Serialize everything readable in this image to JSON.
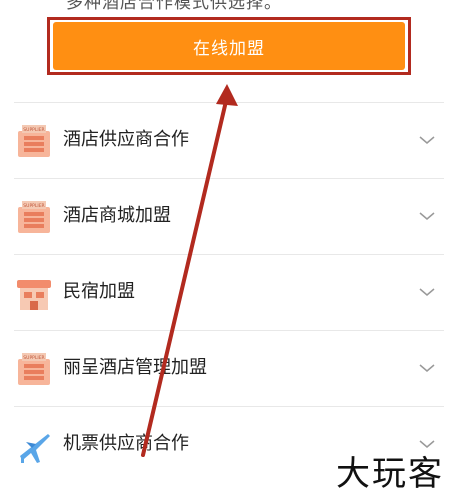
{
  "intro": {
    "text": "多种酒店合作模式供选择。"
  },
  "cta": {
    "label": "在线加盟"
  },
  "menu": {
    "items": [
      {
        "label": "酒店供应商合作",
        "icon": "supplier-icon",
        "badge": "SUPPLIER"
      },
      {
        "label": "酒店商城加盟",
        "icon": "supplier-icon",
        "badge": "SUPPLIER"
      },
      {
        "label": "民宿加盟",
        "icon": "homestay-icon",
        "badge": ""
      },
      {
        "label": "丽呈酒店管理加盟",
        "icon": "supplier-icon",
        "badge": "SUPPLIER"
      },
      {
        "label": "机票供应商合作",
        "icon": "airplane-icon",
        "badge": ""
      }
    ]
  },
  "watermark": {
    "text": "大玩客"
  },
  "colors": {
    "cta": "#ff8f12",
    "highlight": "#b22a1f",
    "icon_peach": "#f7b59a",
    "plane": "#5aa6e8"
  }
}
